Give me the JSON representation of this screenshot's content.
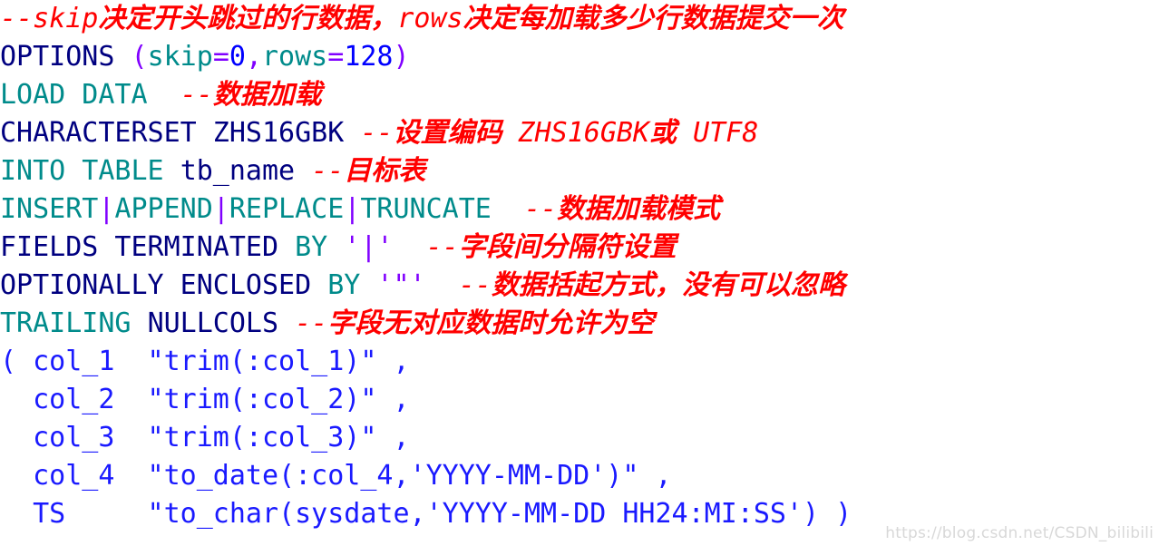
{
  "document": {
    "kind": "sqlloader-control-file",
    "watermark": "https://blog.csdn.net/CSDN_bilibili"
  },
  "lines": [
    {
      "id": "line-1-skip-rows-comment",
      "tokens": [
        {
          "text": "--skip",
          "style": "comment"
        },
        {
          "text": "决定开头跳过的行数据，",
          "style": "comment-cjk"
        },
        {
          "text": "rows",
          "style": "comment"
        },
        {
          "text": "决定每加载多少行数据提交一次",
          "style": "comment-cjk"
        }
      ]
    },
    {
      "id": "line-2-options",
      "tokens": [
        {
          "text": "OPTIONS",
          "style": "navy"
        },
        {
          "text": " ",
          "style": "plain"
        },
        {
          "text": "(",
          "style": "punct"
        },
        {
          "text": "skip",
          "style": "keyword"
        },
        {
          "text": "=",
          "style": "punct"
        },
        {
          "text": "0",
          "style": "number"
        },
        {
          "text": ",",
          "style": "punct"
        },
        {
          "text": "rows",
          "style": "keyword"
        },
        {
          "text": "=",
          "style": "punct"
        },
        {
          "text": "128",
          "style": "number"
        },
        {
          "text": ")",
          "style": "punct"
        }
      ]
    },
    {
      "id": "line-3-load-data",
      "tokens": [
        {
          "text": "LOAD DATA",
          "style": "keyword"
        },
        {
          "text": "  ",
          "style": "plain"
        },
        {
          "text": "--",
          "style": "comment"
        },
        {
          "text": "数据加载",
          "style": "comment-cjk"
        }
      ]
    },
    {
      "id": "line-4-characterset",
      "tokens": [
        {
          "text": "CHARACTERSET ZHS16GBK",
          "style": "navy"
        },
        {
          "text": " ",
          "style": "plain"
        },
        {
          "text": "--",
          "style": "comment"
        },
        {
          "text": "设置编码",
          "style": "comment-cjk"
        },
        {
          "text": " ZHS16GBK",
          "style": "comment"
        },
        {
          "text": "或",
          "style": "comment-cjk"
        },
        {
          "text": " UTF8",
          "style": "comment"
        }
      ]
    },
    {
      "id": "line-5-into-table",
      "tokens": [
        {
          "text": "INTO TABLE",
          "style": "keyword"
        },
        {
          "text": " ",
          "style": "plain"
        },
        {
          "text": "tb_name",
          "style": "navy"
        },
        {
          "text": " ",
          "style": "plain"
        },
        {
          "text": "--",
          "style": "comment"
        },
        {
          "text": "目标表",
          "style": "comment-cjk"
        }
      ]
    },
    {
      "id": "line-6-load-mode",
      "tokens": [
        {
          "text": "INSERT",
          "style": "keyword"
        },
        {
          "text": "|",
          "style": "punct"
        },
        {
          "text": "APPEND",
          "style": "keyword"
        },
        {
          "text": "|",
          "style": "punct"
        },
        {
          "text": "REPLACE",
          "style": "keyword"
        },
        {
          "text": "|",
          "style": "punct"
        },
        {
          "text": "TRUNCATE",
          "style": "keyword"
        },
        {
          "text": "  ",
          "style": "plain"
        },
        {
          "text": "--",
          "style": "comment"
        },
        {
          "text": "数据加载模式",
          "style": "comment-cjk"
        }
      ]
    },
    {
      "id": "line-7-fields-terminated",
      "tokens": [
        {
          "text": "FIELDS TERMINATED",
          "style": "navy"
        },
        {
          "text": " ",
          "style": "plain"
        },
        {
          "text": "BY",
          "style": "keyword"
        },
        {
          "text": " ",
          "style": "plain"
        },
        {
          "text": "'|'",
          "style": "punct"
        },
        {
          "text": "  ",
          "style": "plain"
        },
        {
          "text": "--",
          "style": "comment"
        },
        {
          "text": "字段间分隔符设置",
          "style": "comment-cjk"
        }
      ]
    },
    {
      "id": "line-8-optionally-enclosed",
      "tokens": [
        {
          "text": "OPTIONALLY ENCLOSED",
          "style": "navy"
        },
        {
          "text": " ",
          "style": "plain"
        },
        {
          "text": "BY",
          "style": "keyword"
        },
        {
          "text": " ",
          "style": "plain"
        },
        {
          "text": "'\"'",
          "style": "punct"
        },
        {
          "text": "  ",
          "style": "plain"
        },
        {
          "text": "--",
          "style": "comment"
        },
        {
          "text": "数据括起方式，没有可以忽略",
          "style": "comment-cjk"
        }
      ]
    },
    {
      "id": "line-9-trailing-nullcols",
      "tokens": [
        {
          "text": "TRAILING",
          "style": "keyword"
        },
        {
          "text": " ",
          "style": "plain"
        },
        {
          "text": "NULLCOLS",
          "style": "navy"
        },
        {
          "text": " ",
          "style": "plain"
        },
        {
          "text": "--",
          "style": "comment"
        },
        {
          "text": "字段无对应数据时允许为空",
          "style": "comment-cjk"
        }
      ]
    },
    {
      "id": "line-10-col-1",
      "tokens": [
        {
          "text": "( col_1  \"trim(:col_1)\" ,",
          "style": "blue"
        }
      ]
    },
    {
      "id": "line-11-col-2",
      "tokens": [
        {
          "text": "  col_2  \"trim(:col_2)\" ,",
          "style": "blue"
        }
      ]
    },
    {
      "id": "line-12-col-3",
      "tokens": [
        {
          "text": "  col_3  \"trim(:col_3)\" ,",
          "style": "blue"
        }
      ]
    },
    {
      "id": "line-13-col-4",
      "tokens": [
        {
          "text": "  col_4  \"to_date(:col_4,'YYYY-MM-DD')\" ,",
          "style": "blue"
        }
      ]
    },
    {
      "id": "line-14-ts",
      "tokens": [
        {
          "text": "  TS     \"to_char(sysdate,'YYYY-MM-DD HH24:MI:SS') )",
          "style": "blue"
        }
      ]
    }
  ]
}
